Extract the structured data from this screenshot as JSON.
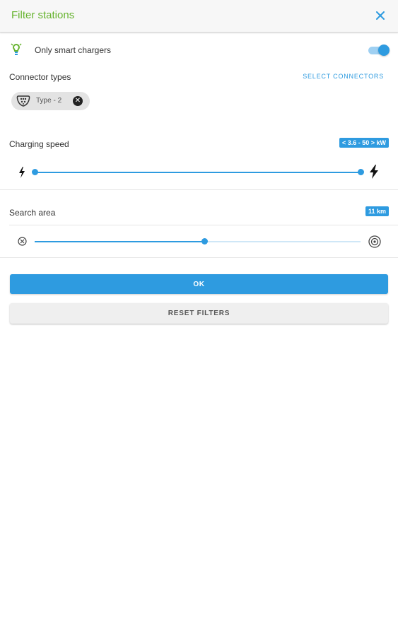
{
  "header": {
    "title": "Filter stations",
    "close_icon": "close-icon"
  },
  "smart_chargers": {
    "label": "Only smart chargers",
    "enabled": true,
    "icon": "smart-bulb-icon"
  },
  "connectors": {
    "label": "Connector types",
    "select_label": "SELECT CONNECTORS",
    "chips": [
      {
        "label": "Type - 2",
        "icon": "type2-plug-icon"
      }
    ]
  },
  "charging_speed": {
    "label": "Charging speed",
    "badge": "< 3.6 - 50 > kW",
    "range_min_fraction": 0.0,
    "range_max_fraction": 1.0,
    "icons": [
      "bolt-small-icon",
      "bolt-large-icon"
    ]
  },
  "search_area": {
    "label": "Search area",
    "badge": "11 km",
    "value_fraction": 0.52,
    "icons": [
      "area-small-icon",
      "area-large-icon"
    ]
  },
  "actions": {
    "ok_label": "OK",
    "reset_label": "RESET FILTERS"
  },
  "colors": {
    "accent": "#2e9be0",
    "title_green": "#66b32e",
    "track_light": "#9fd0f2"
  }
}
